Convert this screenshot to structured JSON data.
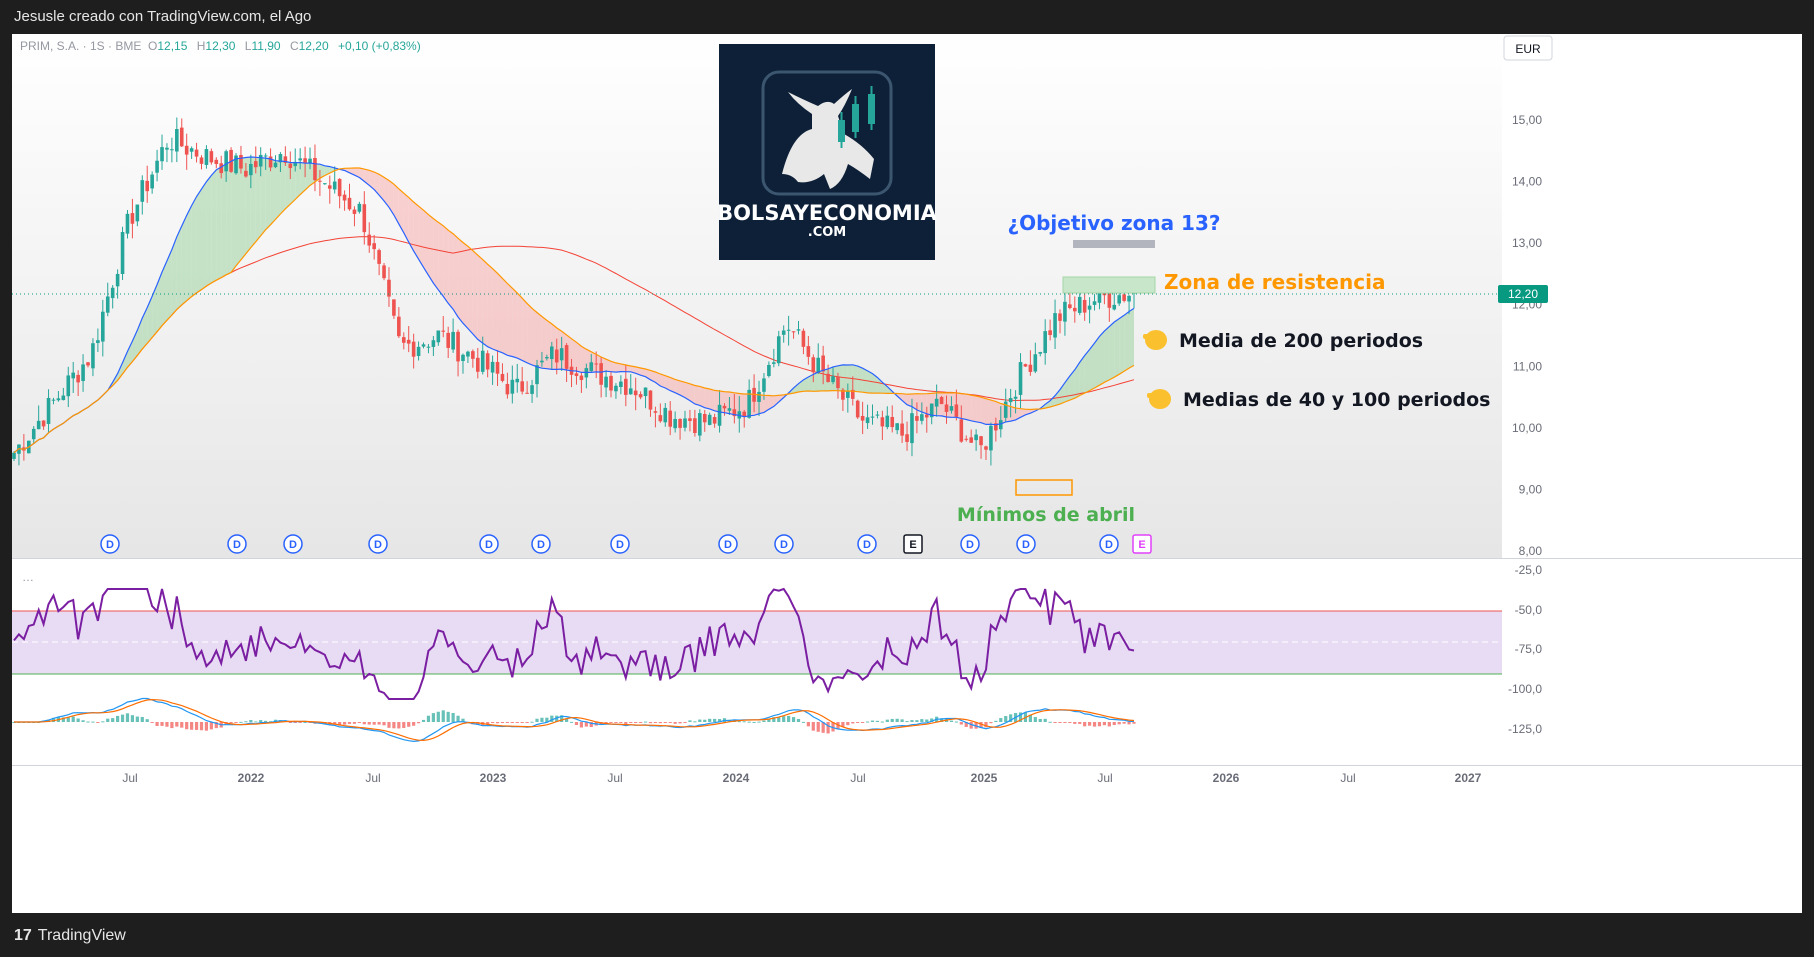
{
  "header": {
    "author_line": "Jesusle creado con TradingView.com, el Ago"
  },
  "footer": {
    "brand": "TradingView"
  },
  "legend": {
    "symbol": "PRIM, S.A. · 1S · BME",
    "o_label": "O",
    "o": "12,15",
    "h_label": "H",
    "h": "12,30",
    "l_label": "L",
    "l": "11,90",
    "c_label": "C",
    "c": "12,20",
    "change": "+0,10 (+0,83%)"
  },
  "currency": "EUR",
  "logo": {
    "line1": "BOLSAYECONOMIA",
    "line2": ".COM"
  },
  "annotations": {
    "target": "¿Objetivo zona 13?",
    "resistance": "Zona de resistencia",
    "ma200": "Media de 200 periodos",
    "ma40_100": "Medias de 40 y 100 periodos",
    "april_lows": "Mínimos de abril"
  },
  "colors": {
    "up": "#26a69a",
    "down": "#ef5350",
    "ma40": "#2962ff",
    "ma100": "#ff9800",
    "ma200": "#f44336",
    "rsi": "#7b1fa2",
    "annotation_blue": "#2962ff",
    "annotation_orange": "#ff9800",
    "annotation_green": "#4caf50",
    "price_label": "#089981"
  },
  "event_markers": {
    "dividend": "D",
    "earnings": "E"
  },
  "chart_data": [
    {
      "type": "candlestick",
      "title": "",
      "y_ticks": [
        "15,00",
        "14,00",
        "13,00",
        "12,00",
        "11,00",
        "10,00",
        "9,00",
        "8,00"
      ],
      "ylim": [
        8.0,
        16.0
      ],
      "x_ticks": [
        "Jul",
        "2022",
        "Jul",
        "2023",
        "Jul",
        "2024",
        "Jul",
        "2025",
        "Jul",
        "2026",
        "Jul",
        "2027"
      ],
      "last_price": "12,20",
      "series_close_approx": {
        "x": [
          "2021-03",
          "2021-05",
          "2021-07",
          "2021-09",
          "2021-11",
          "2022-01",
          "2022-03",
          "2022-05",
          "2022-07",
          "2022-09",
          "2022-11",
          "2023-01",
          "2023-03",
          "2023-05",
          "2023-07",
          "2023-09",
          "2023-11",
          "2024-01",
          "2024-03",
          "2024-05",
          "2024-07",
          "2024-09",
          "2024-11",
          "2025-01",
          "2025-03",
          "2025-04",
          "2025-05",
          "2025-06",
          "2025-07",
          "2025-08"
        ],
        "close": [
          9.6,
          10.4,
          11.2,
          13.4,
          14.7,
          14.4,
          14.2,
          14.5,
          14.0,
          13.5,
          11.3,
          11.5,
          11.1,
          10.6,
          11.2,
          10.9,
          10.7,
          10.2,
          10.1,
          10.4,
          11.7,
          10.8,
          10.1,
          9.9,
          10.4,
          9.6,
          10.8,
          11.8,
          12.1,
          12.2
        ]
      },
      "moving_averages": [
        {
          "name": "Media de 40 periodos",
          "color": "#2962ff"
        },
        {
          "name": "Media de 100 periodos",
          "color": "#ff9800"
        },
        {
          "name": "Media de 200 periodos",
          "color": "#f44336"
        }
      ]
    },
    {
      "type": "line",
      "indicator": "RSI",
      "y_ticks": [
        "-25,0",
        "-50,0",
        "-75,0"
      ],
      "band": [
        30,
        70
      ]
    },
    {
      "type": "histogram",
      "indicator": "MACD",
      "y_ticks": [
        "-100,0",
        "-125,0"
      ]
    }
  ]
}
